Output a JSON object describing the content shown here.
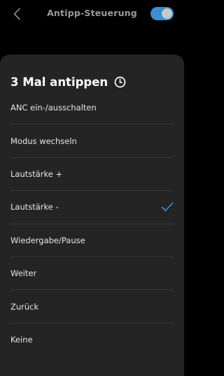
{
  "header": {
    "title": "Antipp-Steuerung",
    "back_icon": "chevron-left-icon",
    "toggle_state": "on",
    "accent_color": "#3a8fd0"
  },
  "sheet": {
    "heading": "3 Mal antippen",
    "heading_icon": "clock-icon",
    "options": [
      {
        "label": "ANC ein-/ausschalten",
        "selected": false
      },
      {
        "label": "Modus wechseln",
        "selected": false
      },
      {
        "label": "Lautstärke +",
        "selected": false
      },
      {
        "label": "Lautstärke -",
        "selected": true
      },
      {
        "label": "Wiedergabe/Pause",
        "selected": false
      },
      {
        "label": "Weiter",
        "selected": false
      },
      {
        "label": "Zurück",
        "selected": false
      },
      {
        "label": "Keine",
        "selected": false
      }
    ]
  }
}
